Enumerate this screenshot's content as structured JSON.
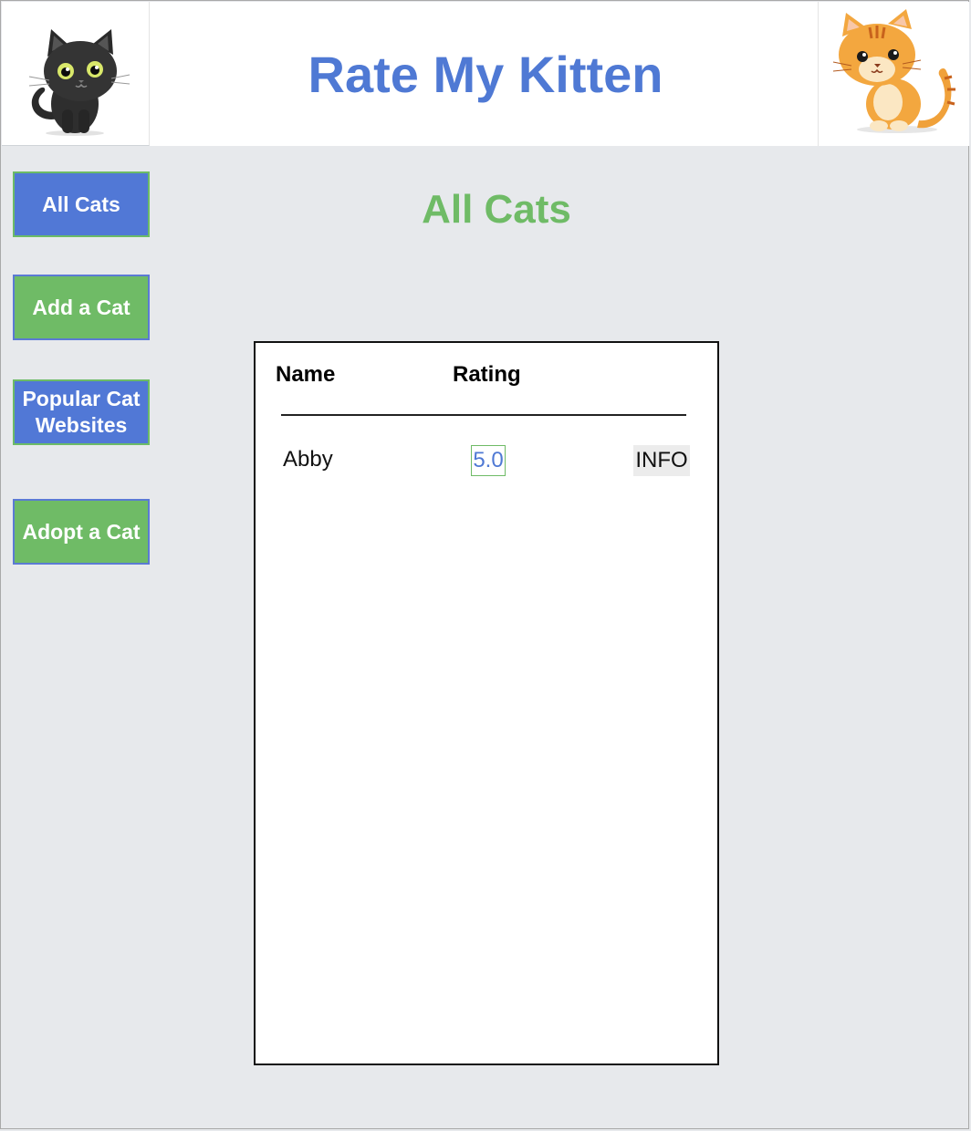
{
  "header": {
    "title": "Rate My Kitten",
    "left_logo_icon": "black-cat-icon",
    "right_logo_icon": "orange-tabby-cat-icon"
  },
  "sidebar": {
    "items": [
      {
        "label": "All Cats",
        "color": "#5178d6",
        "active": true
      },
      {
        "label": "Add a Cat",
        "color": "#6fbb66"
      },
      {
        "label": "Popular Cat Websites",
        "color": "#5178d6"
      },
      {
        "label": "Adopt a Cat",
        "color": "#6fbb66"
      }
    ]
  },
  "main": {
    "heading": "All Cats",
    "table": {
      "columns": [
        "Name",
        "Rating"
      ],
      "rows": [
        {
          "name": "Abby",
          "rating": "5.0",
          "action": "INFO"
        }
      ]
    }
  },
  "colors": {
    "title_blue": "#4f79d4",
    "heading_green": "#6fbb66",
    "page_background": "#e7e9ec"
  }
}
